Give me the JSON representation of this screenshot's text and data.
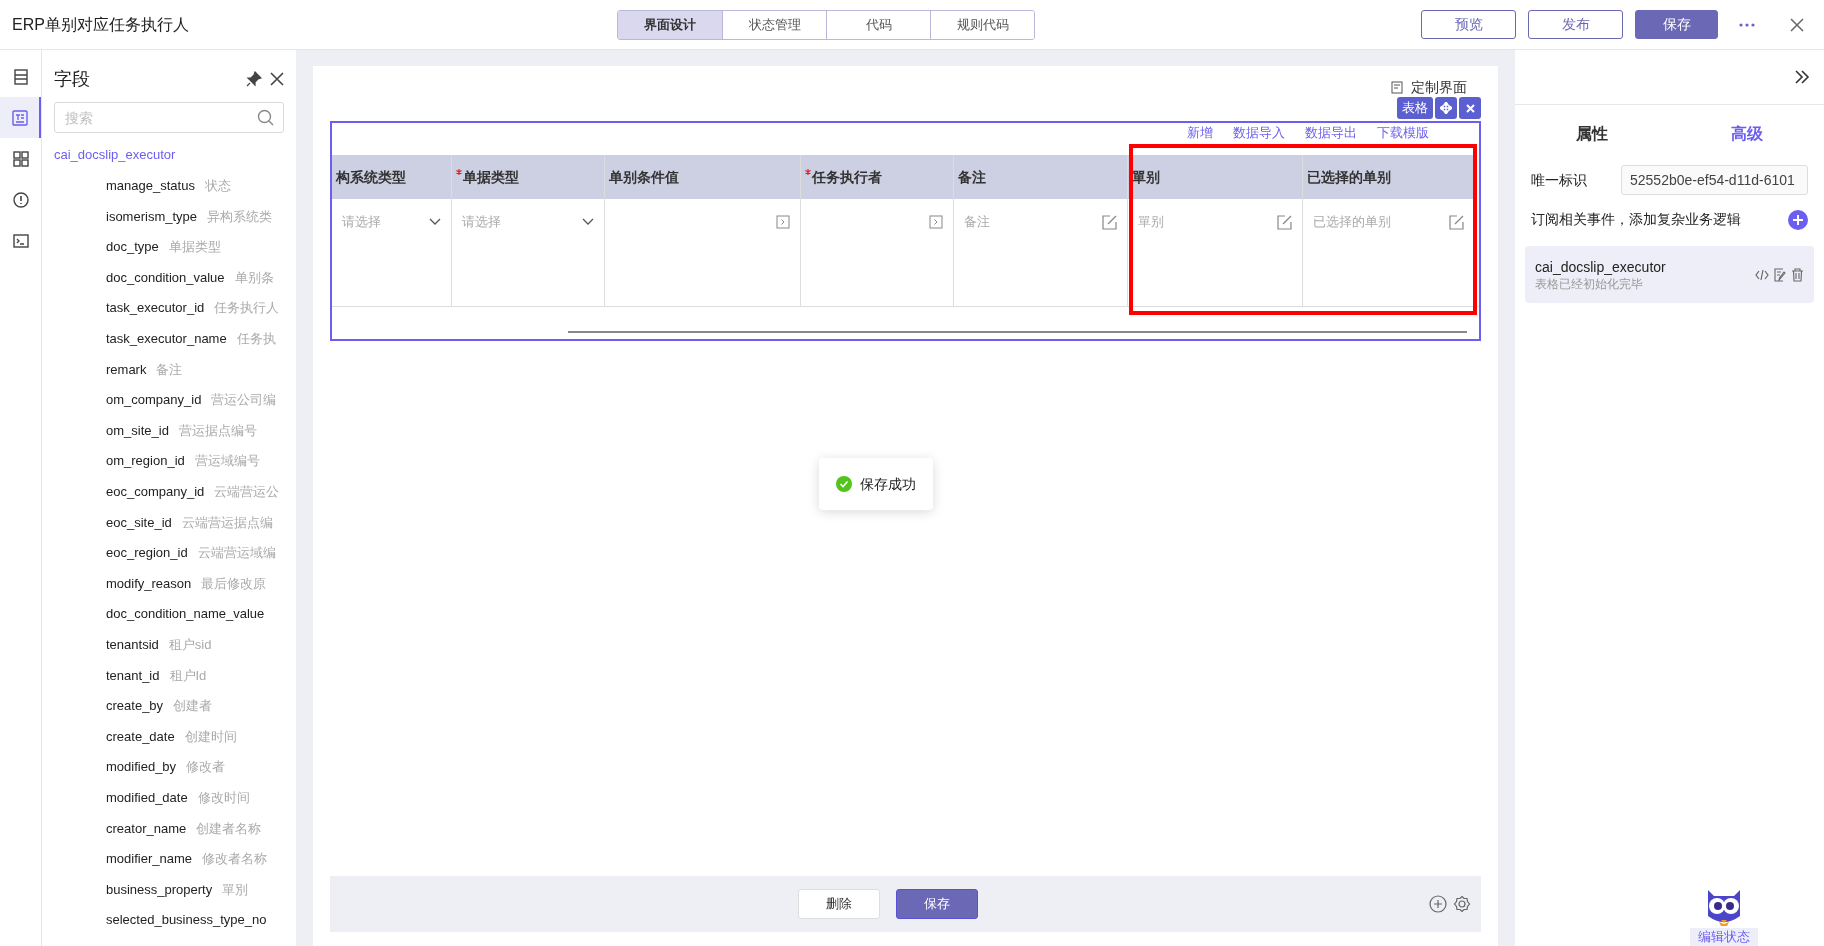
{
  "window": {
    "title": "ERP单别对应任务执行人"
  },
  "top_tabs": [
    {
      "label": "界面设计",
      "selected": true
    },
    {
      "label": "状态管理",
      "selected": false
    },
    {
      "label": "代码",
      "selected": false
    },
    {
      "label": "规则代码",
      "selected": false
    }
  ],
  "top_buttons": [
    {
      "label": "预览",
      "kind": "outline"
    },
    {
      "label": "发布",
      "kind": "outline"
    },
    {
      "label": "保存",
      "kind": "primary"
    }
  ],
  "rail": [
    {
      "selected": false
    },
    {
      "selected": true
    },
    {
      "selected": false
    },
    {
      "selected": false
    },
    {
      "selected": false
    }
  ],
  "field_panel": {
    "title": "字段",
    "search_placeholder": "搜索",
    "table_name": "cai_docslip_executor",
    "fields": [
      {
        "name": "manage_status",
        "label": "状态"
      },
      {
        "name": "isomerism_type",
        "label": "异构系统类"
      },
      {
        "name": "doc_type",
        "label": "单据类型"
      },
      {
        "name": "doc_condition_value",
        "label": "单别条"
      },
      {
        "name": "task_executor_id",
        "label": "任务执行人"
      },
      {
        "name": "task_executor_name",
        "label": "任务执"
      },
      {
        "name": "remark",
        "label": "备注"
      },
      {
        "name": "om_company_id",
        "label": "营运公司编"
      },
      {
        "name": "om_site_id",
        "label": "营运据点编号"
      },
      {
        "name": "om_region_id",
        "label": "营运域编号"
      },
      {
        "name": "eoc_company_id",
        "label": "云端营运公"
      },
      {
        "name": "eoc_site_id",
        "label": "云端营运据点编"
      },
      {
        "name": "eoc_region_id",
        "label": "云端营运域编"
      },
      {
        "name": "modify_reason",
        "label": "最后修改原"
      },
      {
        "name": "doc_condition_name_value"
      },
      {
        "name": "tenantsid",
        "label": "租户sid"
      },
      {
        "name": "tenant_id",
        "label": "租户Id"
      },
      {
        "name": "create_by",
        "label": "创建者"
      },
      {
        "name": "create_date",
        "label": "创建时间"
      },
      {
        "name": "modified_by",
        "label": "修改者"
      },
      {
        "name": "modified_date",
        "label": "修改时间"
      },
      {
        "name": "creator_name",
        "label": "创建者名称"
      },
      {
        "name": "modifier_name",
        "label": "修改者名称"
      },
      {
        "name": "business_property",
        "label": "單別"
      },
      {
        "name": "selected_business_type_no"
      }
    ]
  },
  "canvas": {
    "custom_link": "定制界面",
    "badge": "表格",
    "toolbar_links": [
      "新增",
      "数据导入",
      "数据导出",
      "下载模版"
    ],
    "columns": [
      {
        "header": "构系统类型",
        "required": false,
        "kind": "select",
        "placeholder": "请选择"
      },
      {
        "header": "单据类型",
        "required": true,
        "kind": "select",
        "placeholder": "请选择"
      },
      {
        "header": "单别条件值",
        "required": false,
        "kind": "picker"
      },
      {
        "header": "任务执行者",
        "required": true,
        "kind": "picker"
      },
      {
        "header": "备注",
        "required": false,
        "kind": "edit",
        "placeholder": "备注"
      },
      {
        "header": "單别",
        "required": false,
        "kind": "edit",
        "placeholder": "單别"
      },
      {
        "header": "已选择的单别",
        "required": false,
        "kind": "edit",
        "placeholder": "已选择的单别"
      }
    ],
    "toast": "保存成功",
    "footer_buttons": [
      {
        "label": "删除",
        "kind": "outline"
      },
      {
        "label": "保存",
        "kind": "primary"
      }
    ]
  },
  "right_panel": {
    "tabs": [
      {
        "label": "属性",
        "selected": false
      },
      {
        "label": "高级",
        "selected": true
      }
    ],
    "id_label": "唯一标识",
    "id_value": "52552b0e-ef54-d11d-6101",
    "event_label": "订阅相关事件，添加复杂业务逻辑",
    "event": {
      "name": "cai_docslip_executor",
      "desc": "表格已经初始化完毕"
    },
    "status": "编辑状态"
  }
}
